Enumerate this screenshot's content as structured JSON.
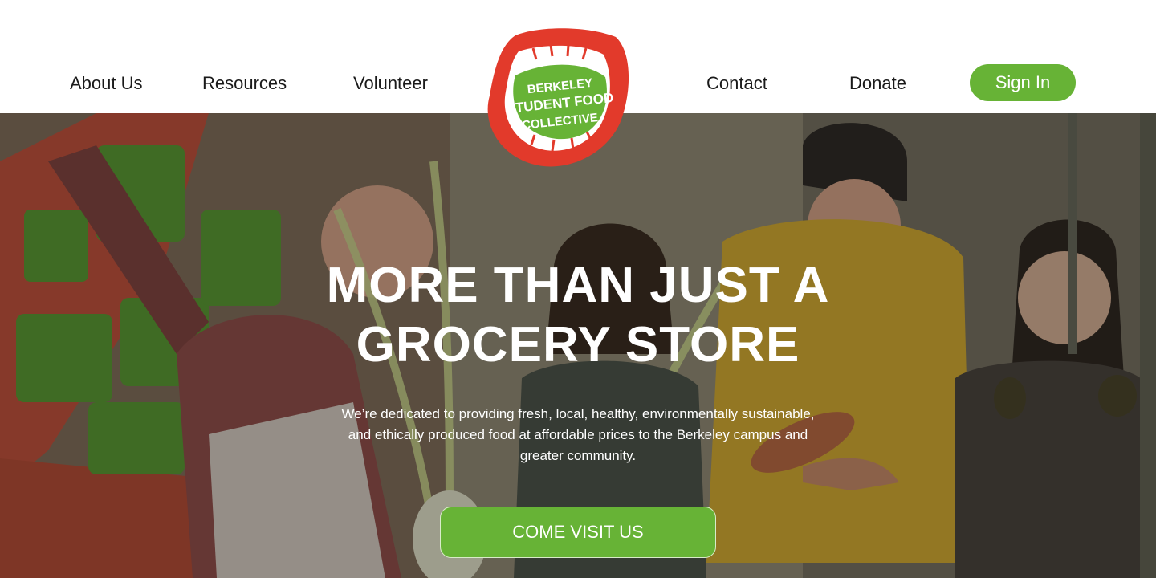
{
  "nav": {
    "about": "About Us",
    "resources": "Resources",
    "volunteer": "Volunteer",
    "contact": "Contact",
    "donate": "Donate",
    "sign_in": "Sign In"
  },
  "logo": {
    "line1": "BERKELEY",
    "line2": "STUDENT FOOD",
    "line3": "COLLECTIVE",
    "icon": "mouth-logo-icon"
  },
  "hero": {
    "title_line1": "MORE THAN JUST A",
    "title_line2": "GROCERY STORE",
    "description": "We’re dedicated to providing fresh, local, healthy, environmentally sustainable, and ethically produced food at affordable prices to the Berkeley campus and greater community.",
    "cta": "COME VISIT US",
    "image": "photo of students holding produce in front of the store"
  },
  "colors": {
    "accent_green": "#67b336",
    "logo_red": "#e23a2b",
    "nav_text": "#1a1a1a"
  }
}
